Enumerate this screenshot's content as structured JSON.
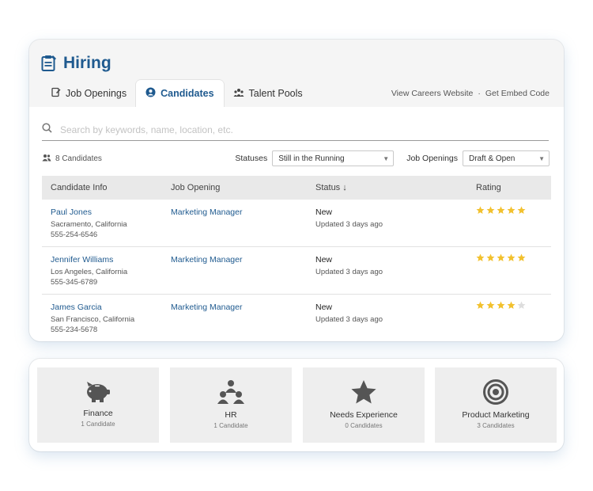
{
  "header": {
    "title": "Hiring"
  },
  "tabs": [
    {
      "label": "Job Openings"
    },
    {
      "label": "Candidates"
    },
    {
      "label": "Talent Pools"
    }
  ],
  "header_links": {
    "careers": "View Careers Website",
    "separator": "·",
    "embed": "Get Embed Code"
  },
  "search": {
    "placeholder": "Search by keywords, name, location, etc."
  },
  "filters": {
    "count": "8 Candidates",
    "statuses_label": "Statuses",
    "statuses_value": "Still in the Running",
    "openings_label": "Job Openings",
    "openings_value": "Draft & Open"
  },
  "table": {
    "headers": [
      "Candidate Info",
      "Job Opening",
      "Status ↓",
      "Rating"
    ],
    "rows": [
      {
        "name": "Paul Jones",
        "location": "Sacramento, California",
        "phone": "555-254-6546",
        "job": "Marketing Manager",
        "status": "New",
        "updated": "Updated 3 days ago",
        "rating": 5
      },
      {
        "name": "Jennifer Williams",
        "location": "Los Angeles, California",
        "phone": "555-345-6789",
        "job": "Marketing Manager",
        "status": "New",
        "updated": "Updated 3 days ago",
        "rating": 5
      },
      {
        "name": "James Garcia",
        "location": "San Francisco, California",
        "phone": "555-234-5678",
        "job": "Marketing Manager",
        "status": "New",
        "updated": "Updated 3 days ago",
        "rating": 4
      }
    ]
  },
  "pools": [
    {
      "name": "Finance",
      "count": "1 Candidate",
      "icon": "piggy-bank-icon"
    },
    {
      "name": "HR",
      "count": "1 Candidate",
      "icon": "people-group-icon"
    },
    {
      "name": "Needs Experience",
      "count": "0 Candidates",
      "icon": "star-icon"
    },
    {
      "name": "Product Marketing",
      "count": "3 Candidates",
      "icon": "target-icon"
    }
  ],
  "colors": {
    "accent": "#1f5a8f",
    "star": "#f2c12e",
    "star_empty": "#dddddd",
    "icon": "#555555"
  }
}
